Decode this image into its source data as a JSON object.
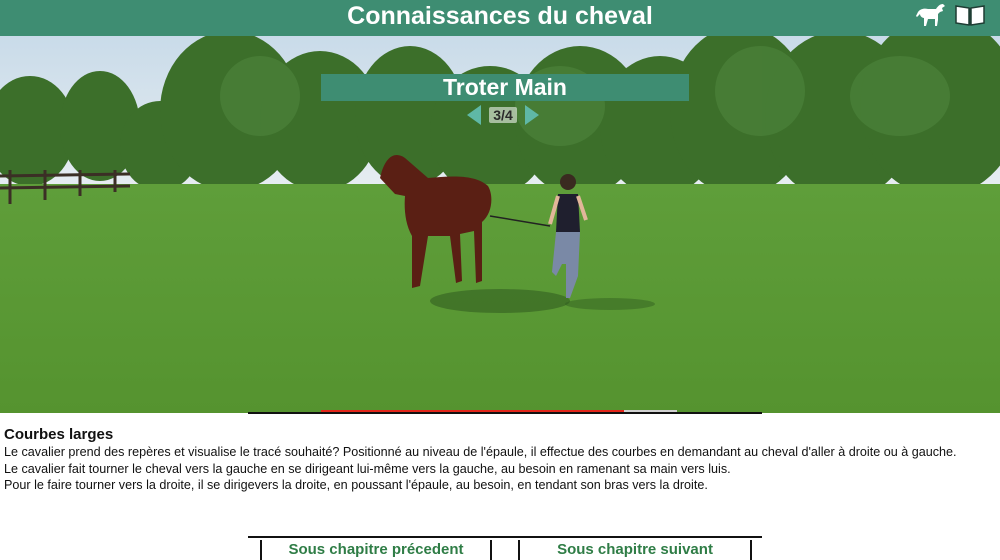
{
  "header": {
    "title": "Connaissances du cheval",
    "icons": [
      "horse-icon",
      "book-icon"
    ]
  },
  "lesson": {
    "chapter_title": "Troter Main",
    "page_counter": "3/4",
    "progress_fraction": 0.85
  },
  "content": {
    "heading": "Courbes larges",
    "paragraphs": [
      "Le cavalier prend des repères et visualise le tracé souhaité? Positionné au niveau de l'épaule, il effectue des courbes en demandant au cheval d'aller à droite ou à gauche.",
      "Le cavalier fait tourner le cheval vers la gauche en se dirigeant lui-même vers la gauche, au besoin en ramenant sa main vers luis.",
      "Pour le faire tourner vers la droite, il se dirigevers la droite, en poussant l'épaule, au besoin, en tendant son bras vers la droite."
    ]
  },
  "navigation": {
    "previous_label": "Sous chapitre précedent",
    "next_label": "Sous chapitre suivant"
  },
  "colors": {
    "header_green": "#3e8d72",
    "progress_red": "#e3261a",
    "nav_text_green": "#2f7d46"
  }
}
